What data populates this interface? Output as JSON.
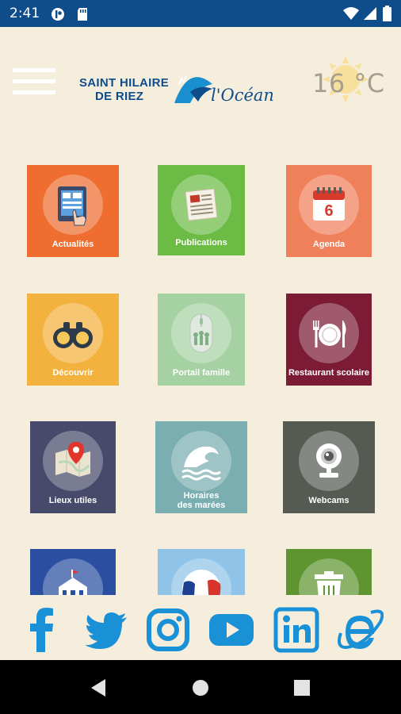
{
  "status_bar": {
    "time": "2:41",
    "icons": [
      "lastpass-icon",
      "sd-card-icon",
      "wifi-icon",
      "signal-icon",
      "battery-icon"
    ]
  },
  "header": {
    "menu_icon": "hamburger-menu-icon",
    "logo": {
      "line1": "SAINT HILAIRE",
      "line2": "DE RIEZ",
      "script": "l'Océan"
    },
    "weather": {
      "temperature": "16 °C",
      "icon": "sun-icon"
    }
  },
  "tiles": [
    {
      "label": "Actualités",
      "icon": "touch-tablet-icon",
      "color": "#ee6d2f"
    },
    {
      "label": "Publications",
      "icon": "newspaper-icon",
      "color": "#6cbb45"
    },
    {
      "label": "Agenda",
      "icon": "calendar-icon",
      "color": "#f0805a",
      "calendar_day": "6"
    },
    {
      "label": "Découvrir",
      "icon": "binoculars-icon",
      "color": "#f3b13d"
    },
    {
      "label": "Portail famille",
      "icon": "mouse-icon",
      "color": "#a6d2a3"
    },
    {
      "label": "Restaurant scolaire",
      "icon": "plate-cutlery-icon",
      "color": "#7b1b35"
    },
    {
      "label": "Lieux utiles",
      "icon": "map-pin-icon",
      "color": "#474a6a"
    },
    {
      "label": "Horaires des marées",
      "label_line1": "Horaires",
      "label_line2": "des marées",
      "icon": "wave-icon",
      "color": "#7aaeb0"
    },
    {
      "label": "Webcams",
      "icon": "webcam-icon",
      "color": "#555a52"
    },
    {
      "label": "",
      "icon": "town-hall-icon",
      "color": "#2a4ea0"
    },
    {
      "label": "",
      "icon": "french-flag-icon",
      "color": "#8fc4e8"
    },
    {
      "label": "",
      "icon": "trash-bin-icon",
      "color": "#5f9530"
    }
  ],
  "social": {
    "color": "#1a90d6",
    "items": [
      "facebook-icon",
      "twitter-icon",
      "instagram-icon",
      "youtube-icon",
      "linkedin-icon",
      "internet-explorer-icon"
    ]
  },
  "nav_bar": [
    "back-icon",
    "home-icon",
    "recents-icon"
  ]
}
